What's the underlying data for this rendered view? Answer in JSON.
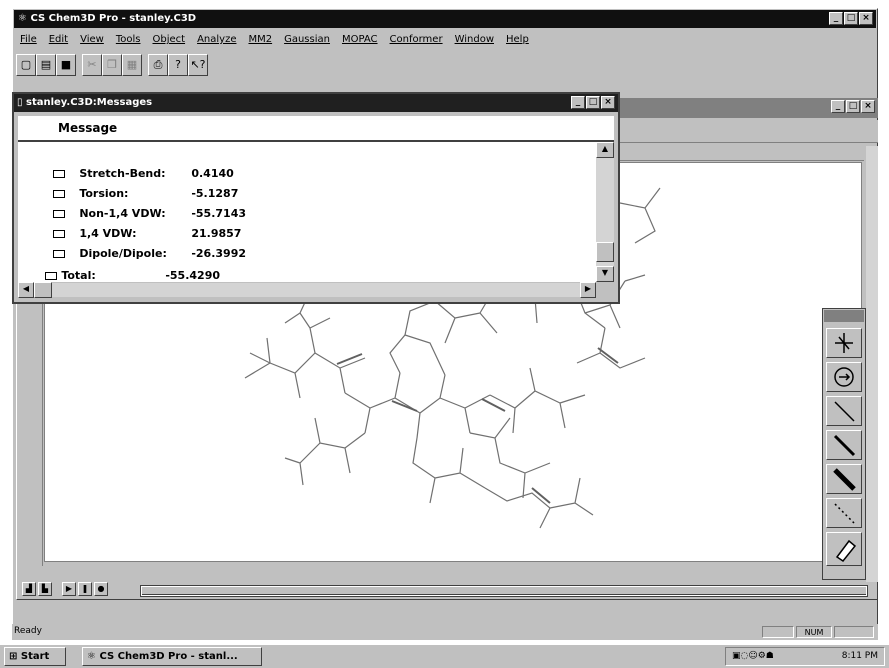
{
  "app": {
    "title": "CS Chem3D Pro - stanley.C3D",
    "window_buttons": [
      "_",
      "□",
      "×"
    ]
  },
  "menu": [
    "File",
    "Edit",
    "View",
    "Tools",
    "Object",
    "Analyze",
    "MM2",
    "Gaussian",
    "MOPAC",
    "Conformer",
    "Window",
    "Help"
  ],
  "toolbar": {
    "icons": [
      "new-icon",
      "open-icon",
      "save-icon",
      "cut-icon",
      "copy-icon",
      "paste-icon",
      "print-icon",
      "help-icon",
      "context-help-icon"
    ]
  },
  "messages_window": {
    "title": "stanley.C3D:Messages",
    "header": "Message",
    "rows": [
      {
        "label": "Stretch-Bend:",
        "value": "0.4140"
      },
      {
        "label": "Torsion:",
        "value": "-5.1287"
      },
      {
        "label": "Non-1,4 VDW:",
        "value": "-55.7143"
      },
      {
        "label": "1,4 VDW:",
        "value": "21.9857"
      },
      {
        "label": "Dipole/Dipole:",
        "value": "-26.3992"
      },
      {
        "label": "Total:",
        "value": "-55.4290"
      }
    ]
  },
  "palette": {
    "tools": [
      "rotate-tool-icon",
      "trackball-icon",
      "single-bond-icon",
      "double-bond-icon",
      "triple-bond-icon",
      "dummy-bond-icon",
      "eraser-icon"
    ]
  },
  "status": {
    "text": "Ready",
    "num": "NUM"
  },
  "taskbar": {
    "start": "Start",
    "task": "CS Chem3D Pro - stanl...",
    "clock": "8:11 PM"
  },
  "colors": {
    "face": "#c0c0c0",
    "title": "#101010"
  }
}
